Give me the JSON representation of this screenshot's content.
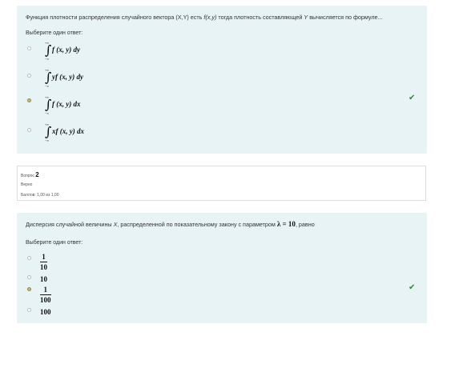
{
  "q1": {
    "text_prefix": "Функция плотности распределения случайного вектора (X,Y) есть ",
    "text_fxy": "f(x,y)",
    "text_mid": " тогда плотность составляющей ",
    "text_Y": "Y",
    "text_suffix": " вычисляется по формуле...",
    "prompt": "Выберите один ответ:",
    "options": [
      {
        "upper": "+∞",
        "lower": "−∞",
        "expr": "f (x, y) dy",
        "selected": false
      },
      {
        "upper": "+∞",
        "lower": "−∞",
        "expr": "yf (x, y) dy",
        "selected": false
      },
      {
        "upper": "+∞",
        "lower": "−∞",
        "expr": "f (x, y) dx",
        "selected": true
      },
      {
        "upper": "+∞",
        "lower": "−∞",
        "expr": "xf (x, y) dx",
        "selected": false
      }
    ]
  },
  "info": {
    "label": "Вопрос",
    "number": "2",
    "status": "Верно",
    "score": "Баллов: 1,00 из 1,00"
  },
  "q2": {
    "text_prefix": "Дисперсия случайной величины ",
    "text_X": "X",
    "text_mid": ", распределенной по показательному закону с параметром ",
    "param": "λ = 10",
    "text_suffix": ", равно",
    "prompt": "Выберите один ответ:",
    "options": [
      {
        "num": "1",
        "den": "10",
        "selected": false
      },
      {
        "value": "10",
        "selected": false
      },
      {
        "num": "1",
        "den": "100",
        "selected": true
      },
      {
        "value": "100",
        "selected": false
      }
    ]
  },
  "colors": {
    "box_bg": "#e7f3f5",
    "check": "#2f8a3a"
  },
  "icons": {
    "correct": "check-icon"
  }
}
